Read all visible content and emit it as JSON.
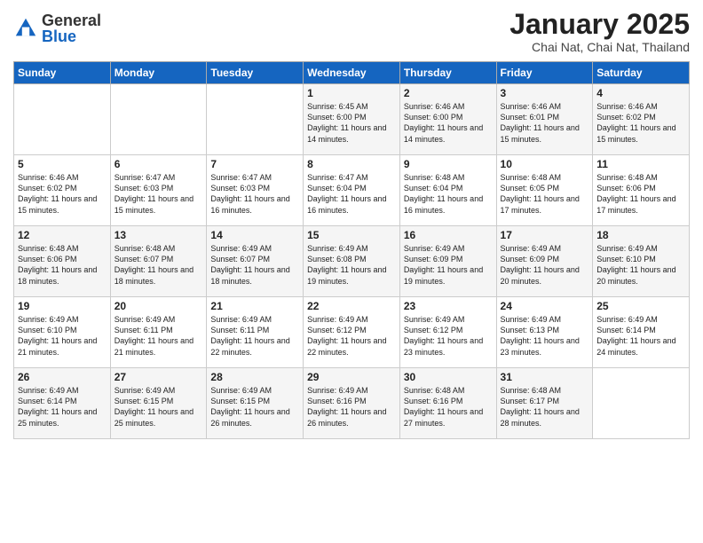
{
  "header": {
    "logo_general": "General",
    "logo_blue": "Blue",
    "month_year": "January 2025",
    "location": "Chai Nat, Chai Nat, Thailand"
  },
  "days_of_week": [
    "Sunday",
    "Monday",
    "Tuesday",
    "Wednesday",
    "Thursday",
    "Friday",
    "Saturday"
  ],
  "weeks": [
    [
      {
        "day": "",
        "text": ""
      },
      {
        "day": "",
        "text": ""
      },
      {
        "day": "",
        "text": ""
      },
      {
        "day": "1",
        "text": "Sunrise: 6:45 AM\nSunset: 6:00 PM\nDaylight: 11 hours and 14 minutes."
      },
      {
        "day": "2",
        "text": "Sunrise: 6:46 AM\nSunset: 6:00 PM\nDaylight: 11 hours and 14 minutes."
      },
      {
        "day": "3",
        "text": "Sunrise: 6:46 AM\nSunset: 6:01 PM\nDaylight: 11 hours and 15 minutes."
      },
      {
        "day": "4",
        "text": "Sunrise: 6:46 AM\nSunset: 6:02 PM\nDaylight: 11 hours and 15 minutes."
      }
    ],
    [
      {
        "day": "5",
        "text": "Sunrise: 6:46 AM\nSunset: 6:02 PM\nDaylight: 11 hours and 15 minutes."
      },
      {
        "day": "6",
        "text": "Sunrise: 6:47 AM\nSunset: 6:03 PM\nDaylight: 11 hours and 15 minutes."
      },
      {
        "day": "7",
        "text": "Sunrise: 6:47 AM\nSunset: 6:03 PM\nDaylight: 11 hours and 16 minutes."
      },
      {
        "day": "8",
        "text": "Sunrise: 6:47 AM\nSunset: 6:04 PM\nDaylight: 11 hours and 16 minutes."
      },
      {
        "day": "9",
        "text": "Sunrise: 6:48 AM\nSunset: 6:04 PM\nDaylight: 11 hours and 16 minutes."
      },
      {
        "day": "10",
        "text": "Sunrise: 6:48 AM\nSunset: 6:05 PM\nDaylight: 11 hours and 17 minutes."
      },
      {
        "day": "11",
        "text": "Sunrise: 6:48 AM\nSunset: 6:06 PM\nDaylight: 11 hours and 17 minutes."
      }
    ],
    [
      {
        "day": "12",
        "text": "Sunrise: 6:48 AM\nSunset: 6:06 PM\nDaylight: 11 hours and 18 minutes."
      },
      {
        "day": "13",
        "text": "Sunrise: 6:48 AM\nSunset: 6:07 PM\nDaylight: 11 hours and 18 minutes."
      },
      {
        "day": "14",
        "text": "Sunrise: 6:49 AM\nSunset: 6:07 PM\nDaylight: 11 hours and 18 minutes."
      },
      {
        "day": "15",
        "text": "Sunrise: 6:49 AM\nSunset: 6:08 PM\nDaylight: 11 hours and 19 minutes."
      },
      {
        "day": "16",
        "text": "Sunrise: 6:49 AM\nSunset: 6:09 PM\nDaylight: 11 hours and 19 minutes."
      },
      {
        "day": "17",
        "text": "Sunrise: 6:49 AM\nSunset: 6:09 PM\nDaylight: 11 hours and 20 minutes."
      },
      {
        "day": "18",
        "text": "Sunrise: 6:49 AM\nSunset: 6:10 PM\nDaylight: 11 hours and 20 minutes."
      }
    ],
    [
      {
        "day": "19",
        "text": "Sunrise: 6:49 AM\nSunset: 6:10 PM\nDaylight: 11 hours and 21 minutes."
      },
      {
        "day": "20",
        "text": "Sunrise: 6:49 AM\nSunset: 6:11 PM\nDaylight: 11 hours and 21 minutes."
      },
      {
        "day": "21",
        "text": "Sunrise: 6:49 AM\nSunset: 6:11 PM\nDaylight: 11 hours and 22 minutes."
      },
      {
        "day": "22",
        "text": "Sunrise: 6:49 AM\nSunset: 6:12 PM\nDaylight: 11 hours and 22 minutes."
      },
      {
        "day": "23",
        "text": "Sunrise: 6:49 AM\nSunset: 6:12 PM\nDaylight: 11 hours and 23 minutes."
      },
      {
        "day": "24",
        "text": "Sunrise: 6:49 AM\nSunset: 6:13 PM\nDaylight: 11 hours and 23 minutes."
      },
      {
        "day": "25",
        "text": "Sunrise: 6:49 AM\nSunset: 6:14 PM\nDaylight: 11 hours and 24 minutes."
      }
    ],
    [
      {
        "day": "26",
        "text": "Sunrise: 6:49 AM\nSunset: 6:14 PM\nDaylight: 11 hours and 25 minutes."
      },
      {
        "day": "27",
        "text": "Sunrise: 6:49 AM\nSunset: 6:15 PM\nDaylight: 11 hours and 25 minutes."
      },
      {
        "day": "28",
        "text": "Sunrise: 6:49 AM\nSunset: 6:15 PM\nDaylight: 11 hours and 26 minutes."
      },
      {
        "day": "29",
        "text": "Sunrise: 6:49 AM\nSunset: 6:16 PM\nDaylight: 11 hours and 26 minutes."
      },
      {
        "day": "30",
        "text": "Sunrise: 6:48 AM\nSunset: 6:16 PM\nDaylight: 11 hours and 27 minutes."
      },
      {
        "day": "31",
        "text": "Sunrise: 6:48 AM\nSunset: 6:17 PM\nDaylight: 11 hours and 28 minutes."
      },
      {
        "day": "",
        "text": ""
      }
    ]
  ]
}
